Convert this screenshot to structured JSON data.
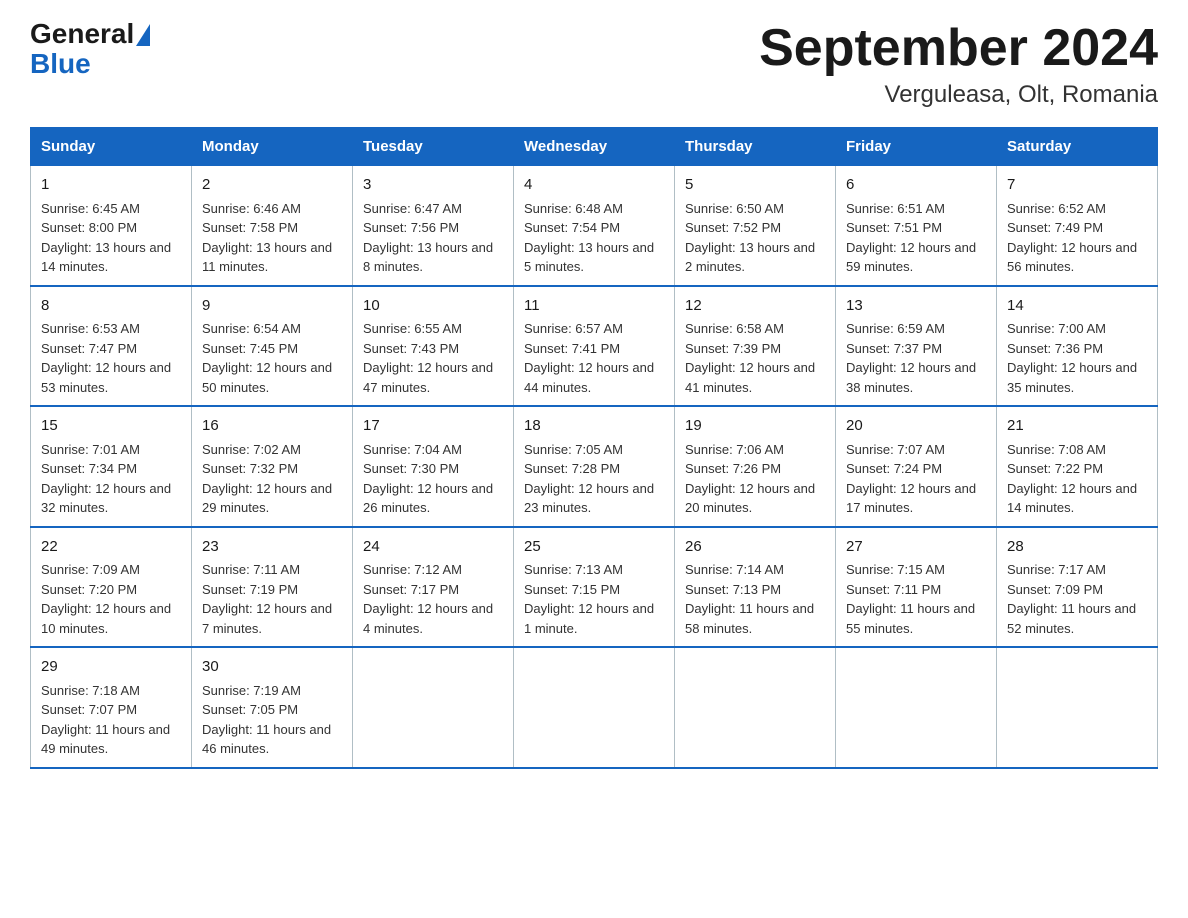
{
  "logo": {
    "general": "General",
    "blue": "Blue"
  },
  "title": "September 2024",
  "subtitle": "Verguleasa, Olt, Romania",
  "days_of_week": [
    "Sunday",
    "Monday",
    "Tuesday",
    "Wednesday",
    "Thursday",
    "Friday",
    "Saturday"
  ],
  "weeks": [
    [
      {
        "day": "1",
        "sunrise": "6:45 AM",
        "sunset": "8:00 PM",
        "daylight": "13 hours and 14 minutes."
      },
      {
        "day": "2",
        "sunrise": "6:46 AM",
        "sunset": "7:58 PM",
        "daylight": "13 hours and 11 minutes."
      },
      {
        "day": "3",
        "sunrise": "6:47 AM",
        "sunset": "7:56 PM",
        "daylight": "13 hours and 8 minutes."
      },
      {
        "day": "4",
        "sunrise": "6:48 AM",
        "sunset": "7:54 PM",
        "daylight": "13 hours and 5 minutes."
      },
      {
        "day": "5",
        "sunrise": "6:50 AM",
        "sunset": "7:52 PM",
        "daylight": "13 hours and 2 minutes."
      },
      {
        "day": "6",
        "sunrise": "6:51 AM",
        "sunset": "7:51 PM",
        "daylight": "12 hours and 59 minutes."
      },
      {
        "day": "7",
        "sunrise": "6:52 AM",
        "sunset": "7:49 PM",
        "daylight": "12 hours and 56 minutes."
      }
    ],
    [
      {
        "day": "8",
        "sunrise": "6:53 AM",
        "sunset": "7:47 PM",
        "daylight": "12 hours and 53 minutes."
      },
      {
        "day": "9",
        "sunrise": "6:54 AM",
        "sunset": "7:45 PM",
        "daylight": "12 hours and 50 minutes."
      },
      {
        "day": "10",
        "sunrise": "6:55 AM",
        "sunset": "7:43 PM",
        "daylight": "12 hours and 47 minutes."
      },
      {
        "day": "11",
        "sunrise": "6:57 AM",
        "sunset": "7:41 PM",
        "daylight": "12 hours and 44 minutes."
      },
      {
        "day": "12",
        "sunrise": "6:58 AM",
        "sunset": "7:39 PM",
        "daylight": "12 hours and 41 minutes."
      },
      {
        "day": "13",
        "sunrise": "6:59 AM",
        "sunset": "7:37 PM",
        "daylight": "12 hours and 38 minutes."
      },
      {
        "day": "14",
        "sunrise": "7:00 AM",
        "sunset": "7:36 PM",
        "daylight": "12 hours and 35 minutes."
      }
    ],
    [
      {
        "day": "15",
        "sunrise": "7:01 AM",
        "sunset": "7:34 PM",
        "daylight": "12 hours and 32 minutes."
      },
      {
        "day": "16",
        "sunrise": "7:02 AM",
        "sunset": "7:32 PM",
        "daylight": "12 hours and 29 minutes."
      },
      {
        "day": "17",
        "sunrise": "7:04 AM",
        "sunset": "7:30 PM",
        "daylight": "12 hours and 26 minutes."
      },
      {
        "day": "18",
        "sunrise": "7:05 AM",
        "sunset": "7:28 PM",
        "daylight": "12 hours and 23 minutes."
      },
      {
        "day": "19",
        "sunrise": "7:06 AM",
        "sunset": "7:26 PM",
        "daylight": "12 hours and 20 minutes."
      },
      {
        "day": "20",
        "sunrise": "7:07 AM",
        "sunset": "7:24 PM",
        "daylight": "12 hours and 17 minutes."
      },
      {
        "day": "21",
        "sunrise": "7:08 AM",
        "sunset": "7:22 PM",
        "daylight": "12 hours and 14 minutes."
      }
    ],
    [
      {
        "day": "22",
        "sunrise": "7:09 AM",
        "sunset": "7:20 PM",
        "daylight": "12 hours and 10 minutes."
      },
      {
        "day": "23",
        "sunrise": "7:11 AM",
        "sunset": "7:19 PM",
        "daylight": "12 hours and 7 minutes."
      },
      {
        "day": "24",
        "sunrise": "7:12 AM",
        "sunset": "7:17 PM",
        "daylight": "12 hours and 4 minutes."
      },
      {
        "day": "25",
        "sunrise": "7:13 AM",
        "sunset": "7:15 PM",
        "daylight": "12 hours and 1 minute."
      },
      {
        "day": "26",
        "sunrise": "7:14 AM",
        "sunset": "7:13 PM",
        "daylight": "11 hours and 58 minutes."
      },
      {
        "day": "27",
        "sunrise": "7:15 AM",
        "sunset": "7:11 PM",
        "daylight": "11 hours and 55 minutes."
      },
      {
        "day": "28",
        "sunrise": "7:17 AM",
        "sunset": "7:09 PM",
        "daylight": "11 hours and 52 minutes."
      }
    ],
    [
      {
        "day": "29",
        "sunrise": "7:18 AM",
        "sunset": "7:07 PM",
        "daylight": "11 hours and 49 minutes."
      },
      {
        "day": "30",
        "sunrise": "7:19 AM",
        "sunset": "7:05 PM",
        "daylight": "11 hours and 46 minutes."
      },
      null,
      null,
      null,
      null,
      null
    ]
  ]
}
